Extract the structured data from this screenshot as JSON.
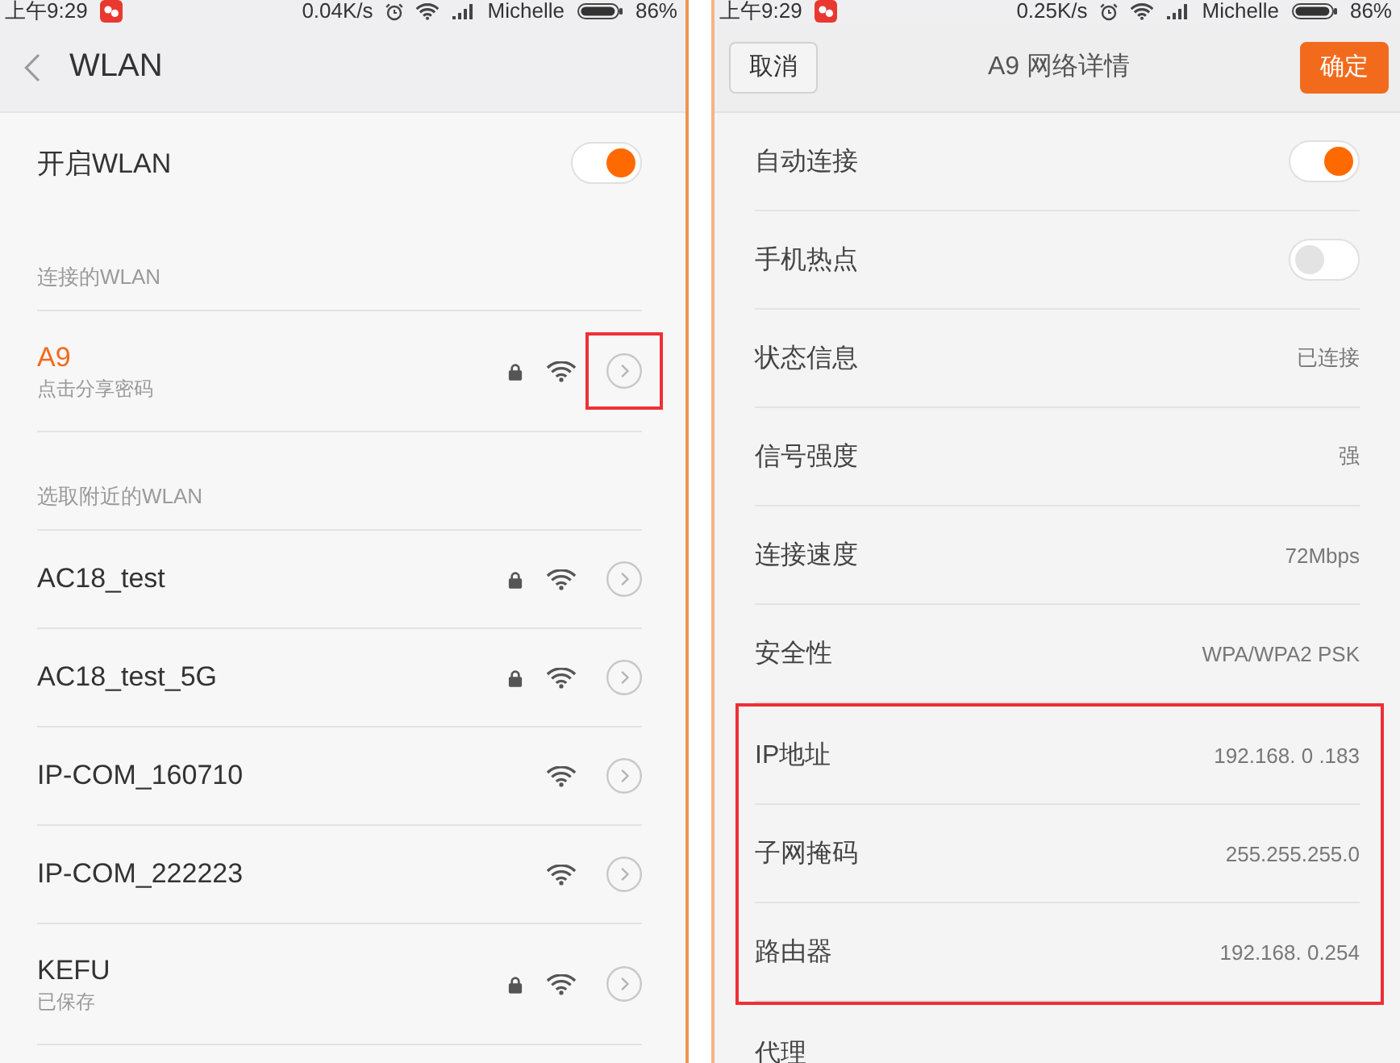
{
  "wlan_screen": {
    "status_bar": {
      "time": "上午9:29",
      "speed": "0.04K/s",
      "carrier": "Michelle",
      "battery": "86%"
    },
    "header": {
      "title": "WLAN"
    },
    "master_toggle": {
      "label": "开启WLAN",
      "on": true
    },
    "sections": [
      {
        "kind": "connected",
        "title": "连接的WLAN",
        "networks": [
          {
            "name": "A9",
            "subtitle": "点击分享密码",
            "secured": true,
            "highlighted": true
          }
        ]
      },
      {
        "kind": "nearby",
        "title": "选取附近的WLAN",
        "networks": [
          {
            "name": "AC18_test",
            "secured": true,
            "highlighted": false
          },
          {
            "name": "AC18_test_5G",
            "secured": true,
            "highlighted": false
          },
          {
            "name": "IP-COM_160710",
            "secured": false,
            "highlighted": false
          },
          {
            "name": "IP-COM_222223",
            "secured": false,
            "highlighted": false
          },
          {
            "name": "KEFU",
            "subtitle": "已保存",
            "secured": true,
            "highlighted": false
          }
        ]
      }
    ]
  },
  "detail_screen": {
    "status_bar": {
      "time": "上午9:29",
      "speed": "0.25K/s",
      "carrier": "Michelle",
      "battery": "86%"
    },
    "header": {
      "cancel": "取消",
      "title": "A9 网络详情",
      "confirm": "确定"
    },
    "rows": [
      {
        "kind": "toggle",
        "label": "自动连接",
        "on": true,
        "highlighted": false
      },
      {
        "kind": "toggle",
        "label": "手机热点",
        "on": false,
        "highlighted": false
      },
      {
        "kind": "info",
        "label": "状态信息",
        "value": "已连接",
        "highlighted": false
      },
      {
        "kind": "info",
        "label": "信号强度",
        "value": "强",
        "highlighted": false
      },
      {
        "kind": "info",
        "label": "连接速度",
        "value": "72Mbps",
        "highlighted": false
      },
      {
        "kind": "info",
        "label": "安全性",
        "value": "WPA/WPA2 PSK",
        "highlighted": false
      },
      {
        "kind": "info",
        "label": "IP地址",
        "value": "192.168. 0 .183",
        "highlighted": true
      },
      {
        "kind": "info",
        "label": "子网掩码",
        "value": "255.255.255.0",
        "highlighted": true
      },
      {
        "kind": "info",
        "label": "路由器",
        "value": "192.168. 0.254",
        "highlighted": true
      },
      {
        "kind": "info",
        "label": "代理",
        "highlighted": false
      }
    ]
  }
}
